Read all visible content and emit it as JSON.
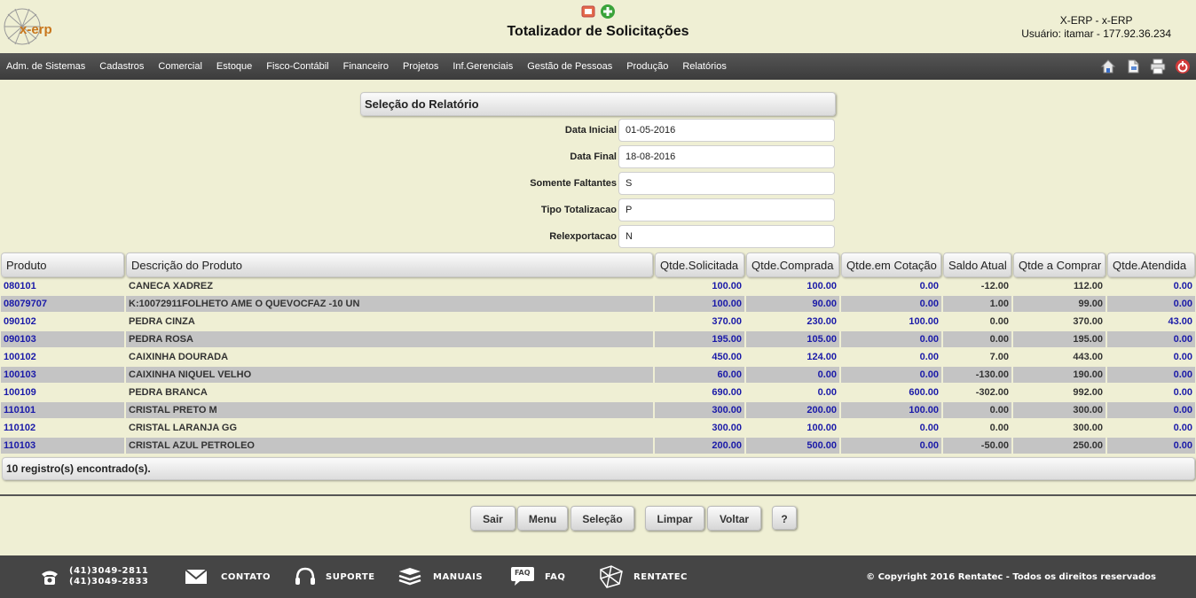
{
  "header": {
    "logo_text": "x-erp",
    "title": "Totalizador de Solicitações",
    "system": "X-ERP - x-ERP",
    "user": "Usuário: itamar - 177.92.36.234"
  },
  "menu": {
    "items": [
      "Adm. de Sistemas",
      "Cadastros",
      "Comercial",
      "Estoque",
      "Fisco-Contábil",
      "Financeiro",
      "Projetos",
      "Inf.Gerenciais",
      "Gestão de Pessoas",
      "Produção",
      "Relatórios"
    ],
    "icons": [
      "home-icon",
      "document-icon",
      "printer-icon",
      "power-icon"
    ]
  },
  "selection": {
    "title": "Seleção do Relatório",
    "fields": [
      {
        "label": "Data Inicial",
        "value": "01-05-2016"
      },
      {
        "label": "Data Final",
        "value": "18-08-2016"
      },
      {
        "label": "Somente Faltantes",
        "value": "S"
      },
      {
        "label": "Tipo Totalizacao",
        "value": "P"
      },
      {
        "label": "Relexportacao",
        "value": "N"
      }
    ]
  },
  "table": {
    "headers": [
      "Produto",
      "Descrição do Produto",
      "Qtde.Solicitada",
      "Qtde.Comprada",
      "Qtde.em Cotação",
      "Saldo Atual",
      "Qtde a Comprar",
      "Qtde.Atendida"
    ],
    "rows": [
      [
        "080101",
        "CANECA XADREZ",
        "100.00",
        "100.00",
        "0.00",
        "-12.00",
        "112.00",
        "0.00"
      ],
      [
        "08079707",
        "K:10072911FOLHETO AME O QUEVOCFAZ -10 UN",
        "100.00",
        "90.00",
        "0.00",
        "1.00",
        "99.00",
        "0.00"
      ],
      [
        "090102",
        "PEDRA CINZA",
        "370.00",
        "230.00",
        "100.00",
        "0.00",
        "370.00",
        "43.00"
      ],
      [
        "090103",
        "PEDRA ROSA",
        "195.00",
        "105.00",
        "0.00",
        "0.00",
        "195.00",
        "0.00"
      ],
      [
        "100102",
        "CAIXINHA DOURADA",
        "450.00",
        "124.00",
        "0.00",
        "7.00",
        "443.00",
        "0.00"
      ],
      [
        "100103",
        "CAIXINHA NIQUEL VELHO",
        "60.00",
        "0.00",
        "0.00",
        "-130.00",
        "190.00",
        "0.00"
      ],
      [
        "100109",
        "PEDRA BRANCA",
        "690.00",
        "0.00",
        "600.00",
        "-302.00",
        "992.00",
        "0.00"
      ],
      [
        "110101",
        "CRISTAL PRETO M",
        "300.00",
        "200.00",
        "100.00",
        "0.00",
        "300.00",
        "0.00"
      ],
      [
        "110102",
        "CRISTAL LARANJA GG",
        "300.00",
        "100.00",
        "0.00",
        "0.00",
        "300.00",
        "0.00"
      ],
      [
        "110103",
        "CRISTAL AZUL PETROLEO",
        "200.00",
        "500.00",
        "0.00",
        "-50.00",
        "250.00",
        "0.00"
      ]
    ],
    "footer": "10 registro(s) encontrado(s)."
  },
  "buttons": [
    "Sair",
    "Menu",
    "Seleção",
    "Limpar",
    "Voltar",
    "?"
  ],
  "bottom": {
    "phone1": "(41)3049-2811",
    "phone2": "(41)3049-2833",
    "contato": "CONTATO",
    "suporte": "SUPORTE",
    "manuais": "MANUAIS",
    "faq": "FAQ",
    "faq_icon_text": "FAQ",
    "rentatec": "RENTATEC",
    "copyright": "© Copyright 2016 Rentatec - Todos os direitos reservados"
  },
  "colors": {
    "link_blue": "#1a1aa8",
    "menubar": "#454545",
    "background": "#efefd4",
    "row_alt": "#c4c4c4"
  }
}
